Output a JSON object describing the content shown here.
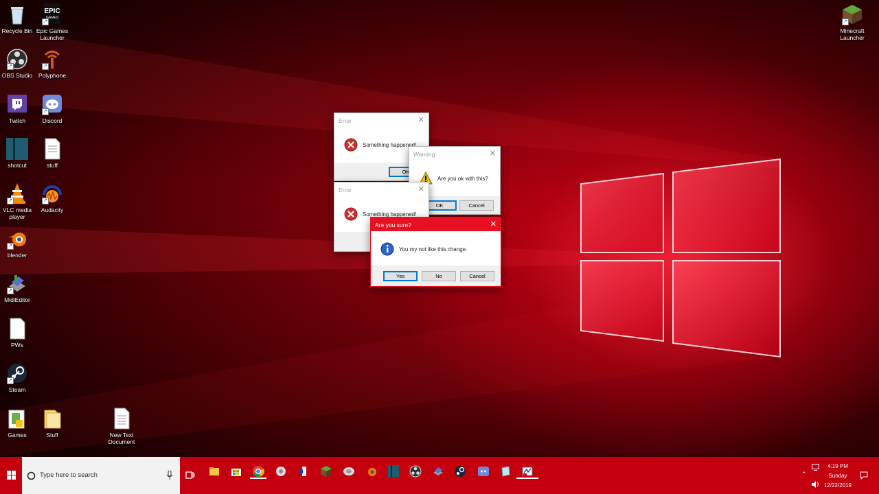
{
  "desktop": {
    "icons_left": [
      {
        "label": "Recycle Bin",
        "icon": "recycle-bin-icon"
      },
      {
        "label": "Epic Games Launcher",
        "icon": "epic-games-icon"
      },
      {
        "label": "OBS Studio",
        "icon": "obs-icon"
      },
      {
        "label": "Polyphone",
        "icon": "polyphone-icon"
      },
      {
        "label": "Twitch",
        "icon": "twitch-icon"
      },
      {
        "label": "Discord",
        "icon": "discord-icon"
      },
      {
        "label": "shotcut",
        "icon": "shotcut-icon"
      },
      {
        "label": "stuff",
        "icon": "text-file-icon"
      },
      {
        "label": "VLC media player",
        "icon": "vlc-icon"
      },
      {
        "label": "Audacity",
        "icon": "audacity-icon"
      },
      {
        "label": "blender",
        "icon": "blender-icon"
      },
      {
        "label": "MidiEditor",
        "icon": "midieditor-icon"
      },
      {
        "label": "PWs",
        "icon": "blank-file-icon"
      },
      {
        "label": "Steam",
        "icon": "steam-icon"
      },
      {
        "label": "Games",
        "icon": "folder-icon"
      },
      {
        "label": "Stuff",
        "icon": "folder-icon"
      },
      {
        "label": "New Text Document",
        "icon": "text-file-icon"
      },
      {
        "label": "Minecraft Launcher",
        "icon": "minecraft-icon"
      }
    ]
  },
  "dialogs": {
    "error1": {
      "title": "Error",
      "message": "Something happened!",
      "ok": "OK"
    },
    "warning": {
      "title": "Warning",
      "message": "Are you ok with this?",
      "ok": "OK",
      "cancel": "Cancel"
    },
    "error2": {
      "title": "Error",
      "message": "Something happened!"
    },
    "confirm": {
      "title": "Are you sure?",
      "message": "You my not like this change.",
      "yes": "Yes",
      "no": "No",
      "cancel": "Cancel"
    }
  },
  "taskbar": {
    "search_placeholder": "Type here to search",
    "pinned": [
      "file-explorer-icon",
      "store-icon",
      "chrome-icon",
      "polyphone-icon",
      "audacity-icon",
      "minecraft-icon",
      "epic-icon",
      "blender-icon",
      "shotcut-icon",
      "obs-icon",
      "midieditor-icon",
      "steam-icon",
      "discord-icon",
      "notepad-icon",
      "vbs-icon"
    ],
    "time": "4:19 PM",
    "day": "Sunday",
    "date": "12/22/2019"
  },
  "colors": {
    "accent": "#e81123",
    "taskbar": "#c4000f"
  }
}
